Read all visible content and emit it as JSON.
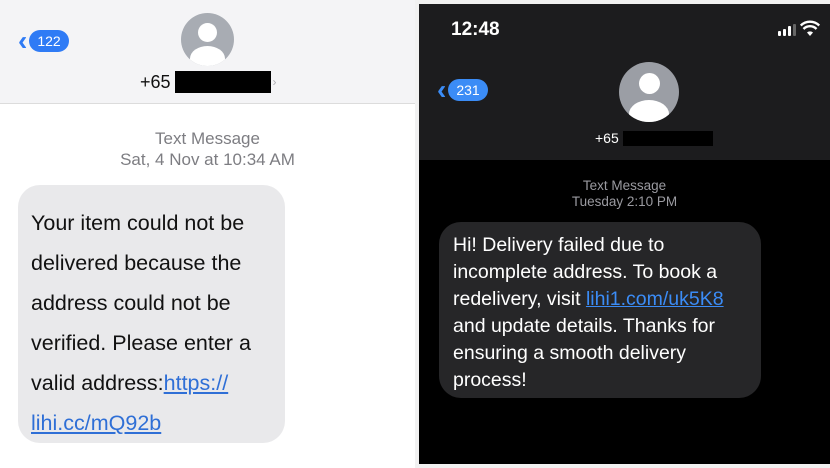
{
  "left": {
    "back_badge": "122",
    "contact_prefix": "+65",
    "meta_title": "Text Message",
    "meta_time": "Sat, 4 Nov at 10:34 AM",
    "message": {
      "text": "Your item could not be delivered because the address could not be verified. Please enter a valid address:",
      "link": "https:// lihi.cc/mQ92b"
    },
    "colors": {
      "accent": "#2f7bf5",
      "bubble": "#e9e9eb",
      "header": "#f4f4f6"
    }
  },
  "right": {
    "status_time": "12:48",
    "back_badge": "231",
    "contact_prefix": "+65",
    "meta_title": "Text Message",
    "meta_time": "Tuesday 2:10 PM",
    "message": {
      "text_before": "Hi! Delivery failed due to incomplete address. To book a redelivery, visit",
      "link": "lihi1.com/uk5K8",
      "text_after": "and update details. Thanks for ensuring a smooth delivery process!"
    },
    "colors": {
      "accent": "#3b8cf6",
      "bubble": "#262628",
      "header": "#1c1c1e"
    }
  }
}
